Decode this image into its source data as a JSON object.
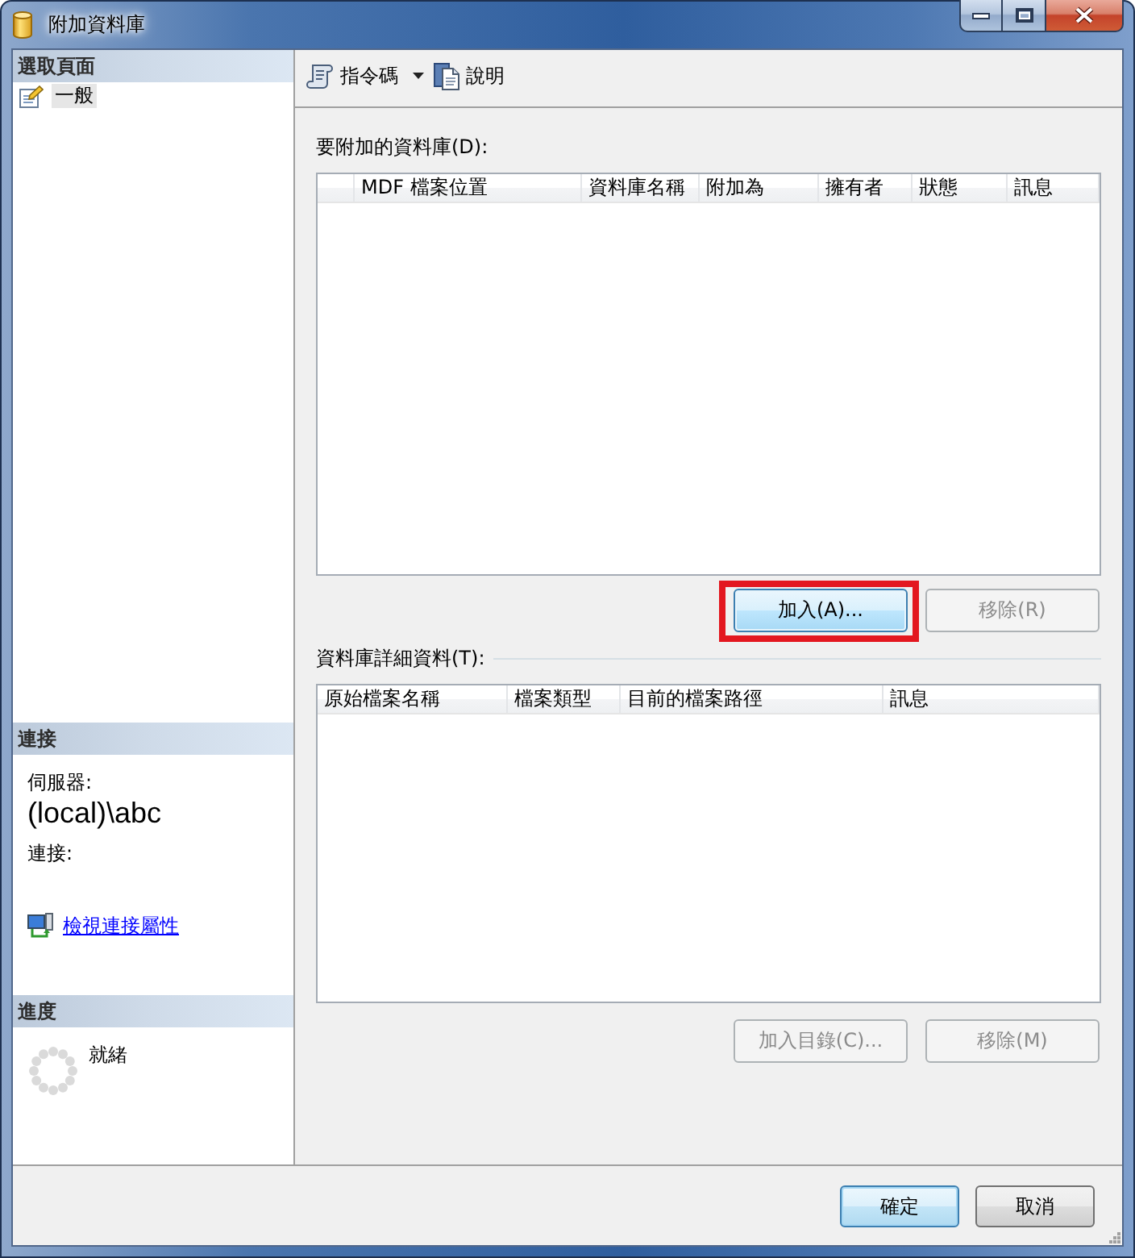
{
  "window": {
    "title": "附加資料庫"
  },
  "sidebar": {
    "pages_header": "選取頁面",
    "pages": [
      {
        "label": "一般",
        "selected": true
      }
    ],
    "connection": {
      "header": "連接",
      "server_label": "伺服器:",
      "server": "(local)\\abc",
      "connection_label": "連接:",
      "link": "檢視連接屬性"
    },
    "progress": {
      "header": "進度",
      "status": "就緒"
    }
  },
  "toolbar": {
    "items": [
      {
        "kind": "script",
        "label": "指令碼",
        "dropdown": true
      },
      {
        "kind": "help",
        "label": "說明",
        "dropdown": false
      }
    ]
  },
  "databases": {
    "label": "要附加的資料庫(D):",
    "columns": [
      "MDF 檔案位置",
      "資料庫名稱",
      "附加為",
      "擁有者",
      "狀態",
      "訊息"
    ],
    "buttons": [
      {
        "label": "加入(A)...",
        "disabled": false,
        "hover": true,
        "highlighted": true
      },
      {
        "label": "移除(R)",
        "disabled": true,
        "hover": false,
        "highlighted": false
      }
    ]
  },
  "details": {
    "label": "資料庫詳細資料(T):",
    "columns": [
      "原始檔案名稱",
      "檔案類型",
      "目前的檔案路徑",
      "訊息"
    ],
    "buttons": [
      {
        "label": "加入目錄(C)...",
        "disabled": true,
        "hover": false,
        "highlighted": false
      },
      {
        "label": "移除(M)",
        "disabled": true,
        "hover": false,
        "highlighted": false
      }
    ]
  },
  "dialog_buttons": [
    {
      "label": "確定",
      "default": true
    },
    {
      "label": "取消",
      "default": false
    }
  ]
}
